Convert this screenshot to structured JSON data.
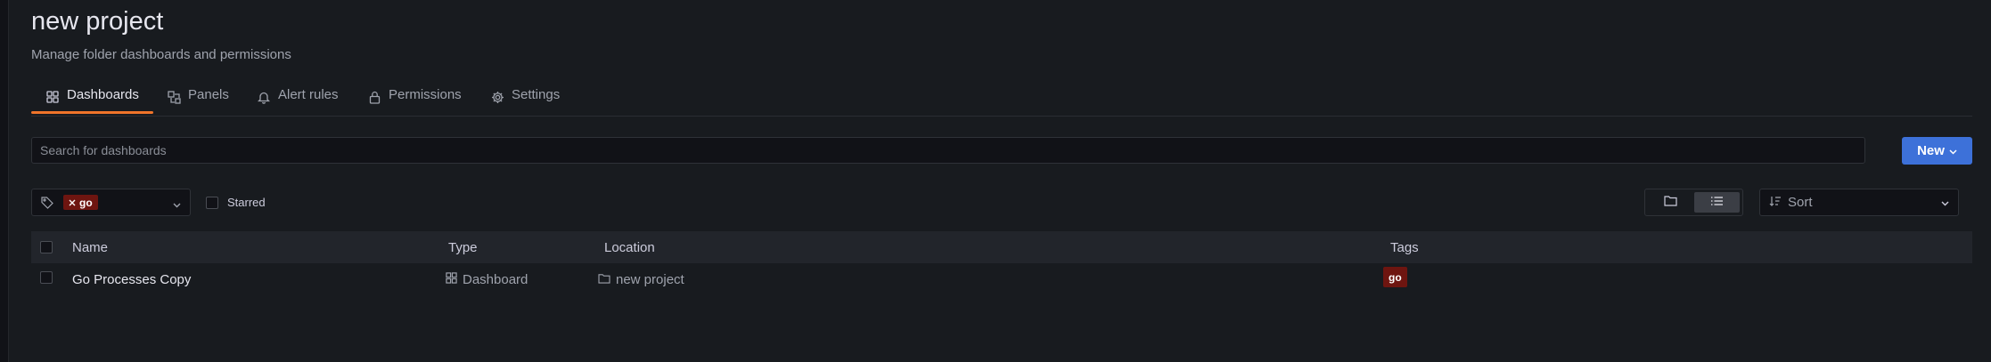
{
  "header": {
    "title": "new project",
    "subtitle": "Manage folder dashboards and permissions"
  },
  "tabs": [
    {
      "label": "Dashboards",
      "icon": "apps-icon",
      "active": true
    },
    {
      "label": "Panels",
      "icon": "library-panel-icon",
      "active": false
    },
    {
      "label": "Alert rules",
      "icon": "bell-icon",
      "active": false
    },
    {
      "label": "Permissions",
      "icon": "lock-icon",
      "active": false
    },
    {
      "label": "Settings",
      "icon": "cog-icon",
      "active": false
    }
  ],
  "search": {
    "placeholder": "Search for dashboards",
    "value": ""
  },
  "new_button": {
    "label": "New"
  },
  "filters": {
    "tag_filter": {
      "selected_tag": "go"
    },
    "starred": {
      "label": "Starred",
      "checked": false
    },
    "view": {
      "active": "list"
    },
    "sort": {
      "placeholder": "Sort"
    }
  },
  "table": {
    "columns": [
      "Name",
      "Type",
      "Location",
      "Tags"
    ],
    "rows": [
      {
        "name": "Go Processes Copy",
        "type": "Dashboard",
        "location": "new project",
        "tags": [
          "go"
        ]
      }
    ]
  },
  "colors": {
    "accent_tab": "#f0742a",
    "primary_button": "#3d71d9",
    "tag_go": "#6e1510"
  }
}
